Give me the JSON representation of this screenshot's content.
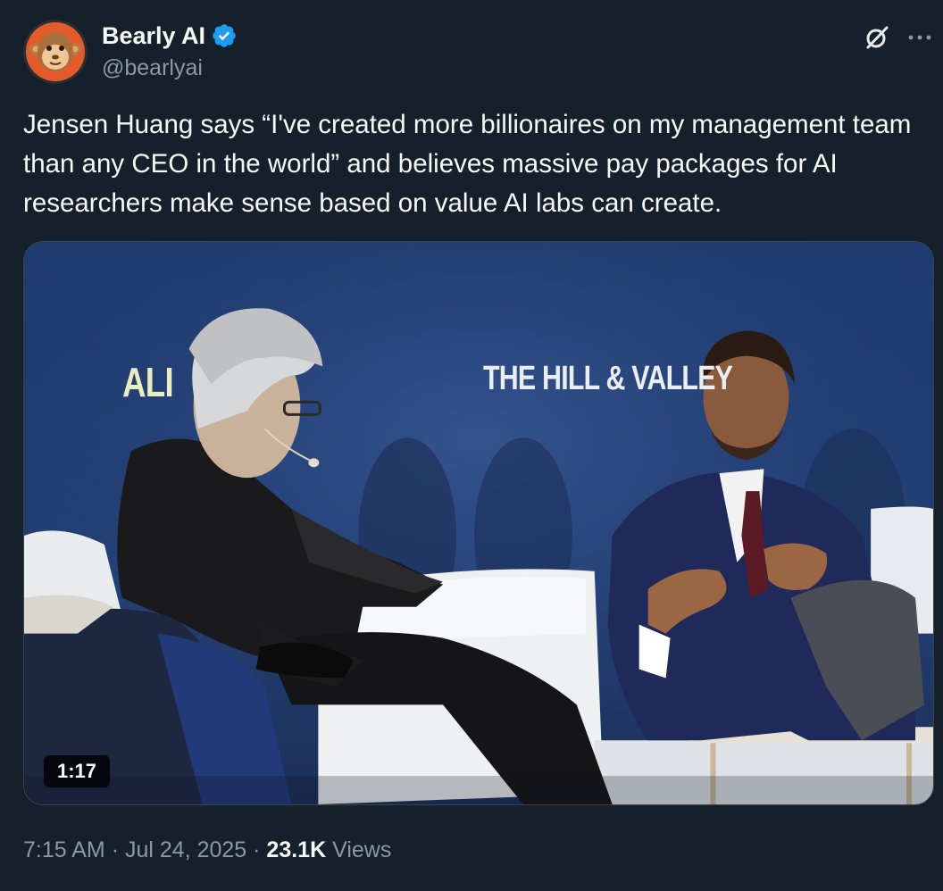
{
  "author": {
    "name": "Bearly AI",
    "handle": "@bearlyai",
    "verified": true,
    "avatar_icon": "monkey-face-icon"
  },
  "icons": {
    "grok": "grok-slash-circle-icon",
    "more": "more-dots-icon",
    "verified": "verified-badge-icon"
  },
  "tweet": {
    "text": "Jensen Huang says “I've created more billionaires on my management team than any CEO in the world” and believes massive pay packages for AI researchers make sense based on value AI labs can create."
  },
  "media": {
    "type": "video",
    "duration": "1:17",
    "backdrop_text_left": "ALI",
    "backdrop_text_right": "THE HILL & VALLEY"
  },
  "meta": {
    "time": "7:15 AM",
    "separator": "·",
    "date": "Jul 24, 2025",
    "views_count": "23.1K",
    "views_label": "Views"
  },
  "colors": {
    "background": "#15202b",
    "text_primary": "#f7f9f9",
    "text_secondary": "#8b98a5",
    "verified_blue": "#1d9bf0",
    "border": "#38444d"
  }
}
